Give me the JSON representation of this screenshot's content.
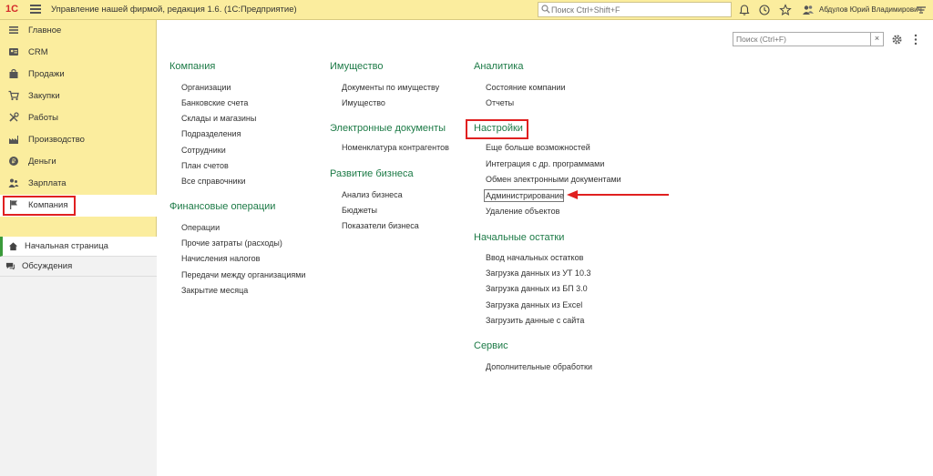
{
  "titlebar": {
    "logo": "1С",
    "title": "Управление нашей фирмой, редакция 1.6. (1С:Предприятие)",
    "search_placeholder": "Поиск Ctrl+Shift+F",
    "user_name": "Абдулов Юрий Владимирович",
    "icons": [
      "menu-icon",
      "search-icon",
      "bell-icon",
      "history-icon",
      "star-icon",
      "user-icon",
      "settings-menu-icon"
    ]
  },
  "sidebar": {
    "items": [
      {
        "label": "Главное",
        "icon": "list-icon"
      },
      {
        "label": "CRM",
        "icon": "contact-card-icon"
      },
      {
        "label": "Продажи",
        "icon": "shopping-bag-icon"
      },
      {
        "label": "Закупки",
        "icon": "cart-icon"
      },
      {
        "label": "Работы",
        "icon": "tools-icon"
      },
      {
        "label": "Производство",
        "icon": "factory-icon"
      },
      {
        "label": "Деньги",
        "icon": "coin-icon"
      },
      {
        "label": "Зарплата",
        "icon": "people-icon"
      },
      {
        "label": "Компания",
        "icon": "flag-icon"
      }
    ],
    "active_item": "Компания",
    "open_windows": [
      {
        "label": "Начальная страница",
        "icon": "home-icon"
      },
      {
        "label": "Обсуждения",
        "icon": "chat-icon"
      }
    ]
  },
  "content": {
    "search_placeholder": "Поиск (Ctrl+F)",
    "clear_label": "×",
    "sections": {
      "company": {
        "title": "Компания",
        "links": [
          "Организации",
          "Банковские счета",
          "Склады и магазины",
          "Подразделения",
          "Сотрудники",
          "План счетов",
          "Все справочники"
        ]
      },
      "finance": {
        "title": "Финансовые операции",
        "links": [
          "Операции",
          "Прочие затраты (расходы)",
          "Начисления налогов",
          "Передачи между организациями",
          "Закрытие месяца"
        ]
      },
      "property": {
        "title": "Имущество",
        "links": [
          "Документы по имуществу",
          "Имущество"
        ]
      },
      "edocs": {
        "title": "Электронные документы",
        "links": [
          "Номенклатура контрагентов"
        ]
      },
      "business": {
        "title": "Развитие бизнеса",
        "links": [
          "Анализ бизнеса",
          "Бюджеты",
          "Показатели бизнеса"
        ]
      },
      "analytics": {
        "title": "Аналитика",
        "links": [
          "Состояние компании",
          "Отчеты"
        ]
      },
      "settings": {
        "title": "Настройки",
        "links": [
          "Еще больше возможностей",
          "Интеграция с др. программами",
          "Обмен электронными документами",
          "Администрирование",
          "Удаление объектов"
        ]
      },
      "initial": {
        "title": "Начальные остатки",
        "links": [
          "Ввод начальных остатков",
          "Загрузка данных из УТ 10.3",
          "Загрузка данных из БП 3.0",
          "Загрузка данных из Excel",
          "Загрузить данные с сайта"
        ]
      },
      "service": {
        "title": "Сервис",
        "links": [
          "Дополнительные обработки"
        ]
      }
    },
    "highlighted_section": "Настройки",
    "pointed_link": "Администрирование"
  },
  "colors": {
    "accent": "#fbed9e",
    "section_title": "#1c7a46",
    "highlight": "#e02020"
  }
}
